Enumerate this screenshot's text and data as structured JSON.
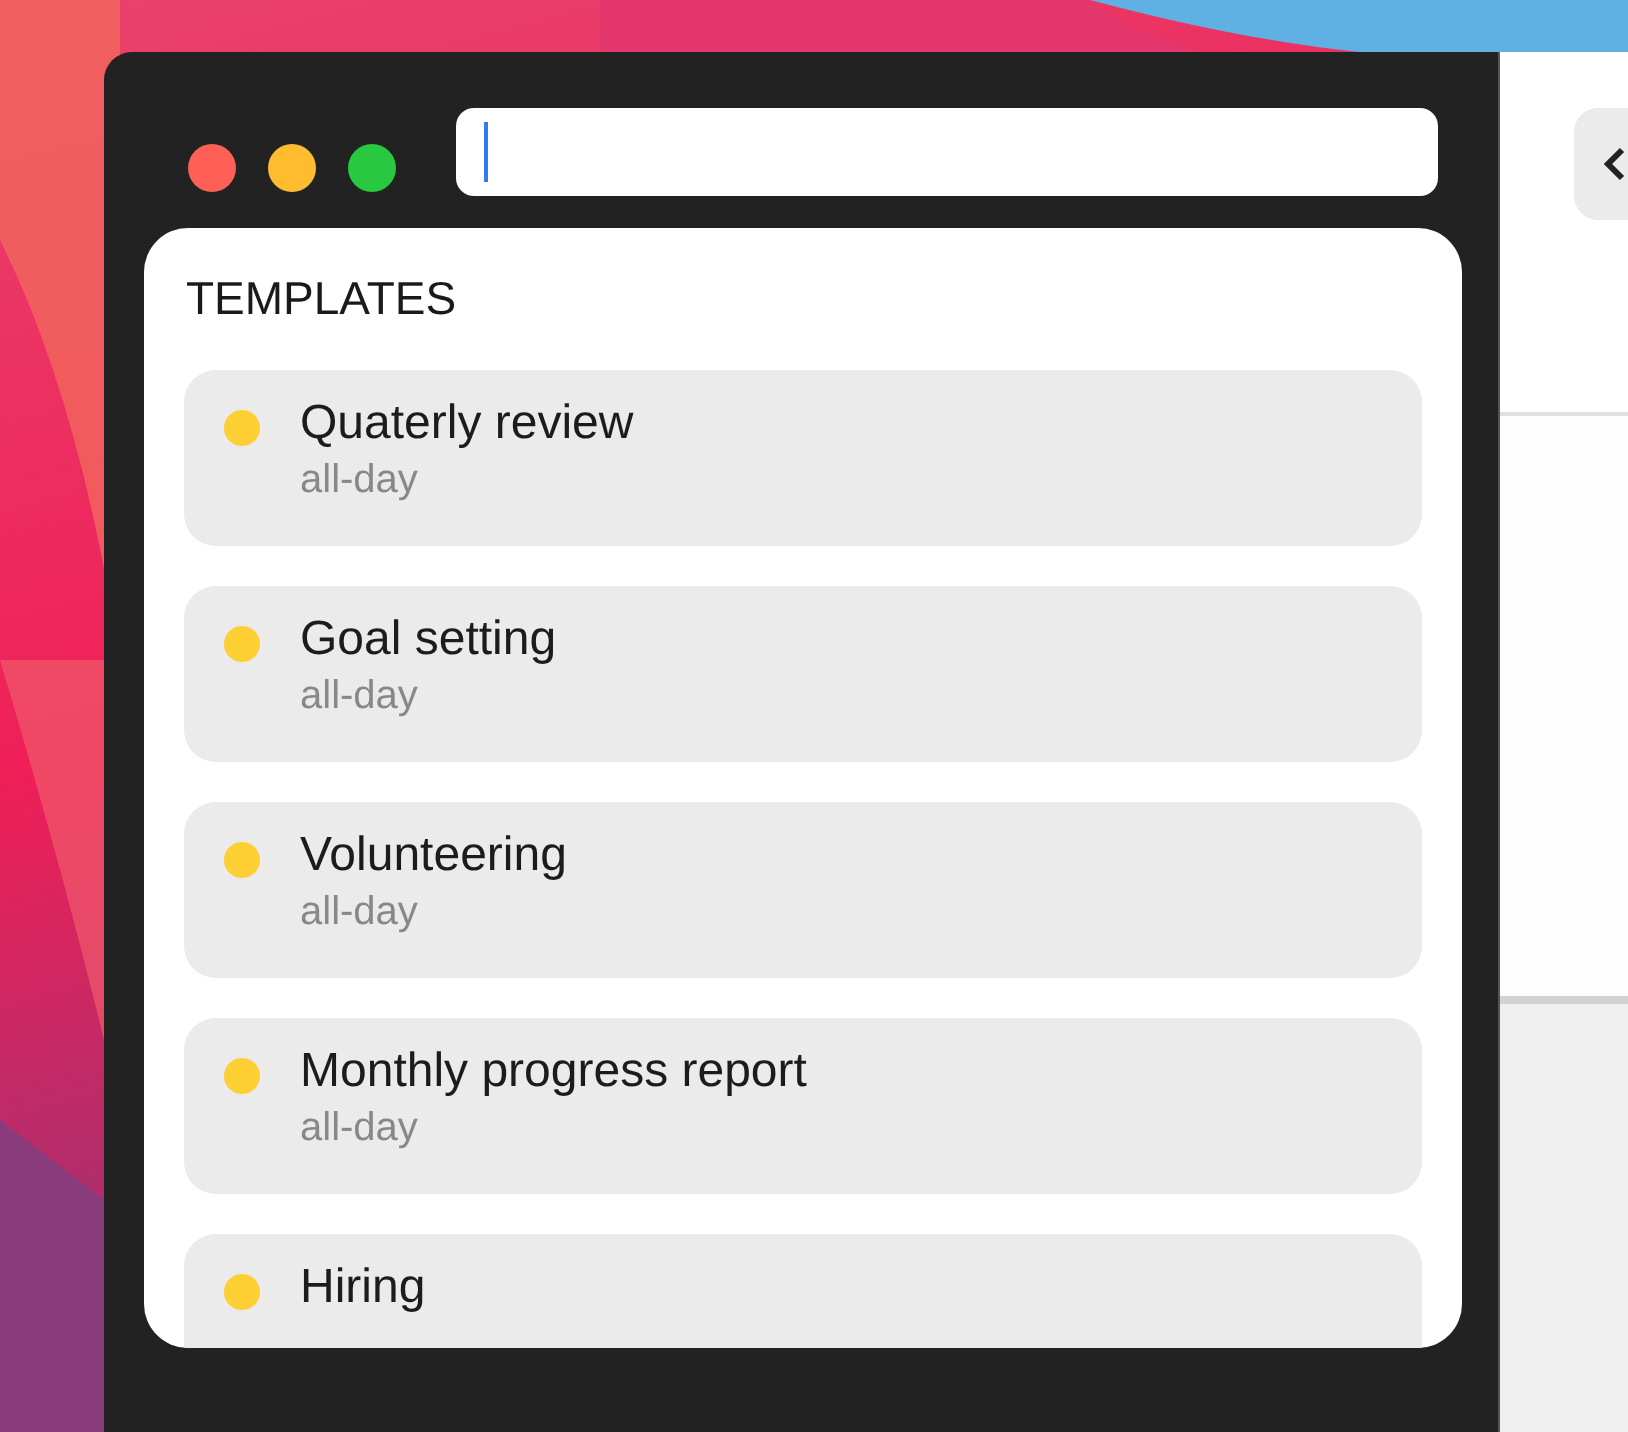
{
  "search": {
    "focused": true
  },
  "templates": {
    "heading": "TEMPLATES",
    "items": [
      {
        "title": "Quaterly review",
        "subtitle": "all-day",
        "color": "#fecf33"
      },
      {
        "title": "Goal setting",
        "subtitle": "all-day",
        "color": "#fecf33"
      },
      {
        "title": "Volunteering",
        "subtitle": "all-day",
        "color": "#fecf33"
      },
      {
        "title": "Monthly progress report",
        "subtitle": "all-day",
        "color": "#fecf33"
      },
      {
        "title": "Hiring",
        "color": "#fecf33"
      }
    ]
  }
}
